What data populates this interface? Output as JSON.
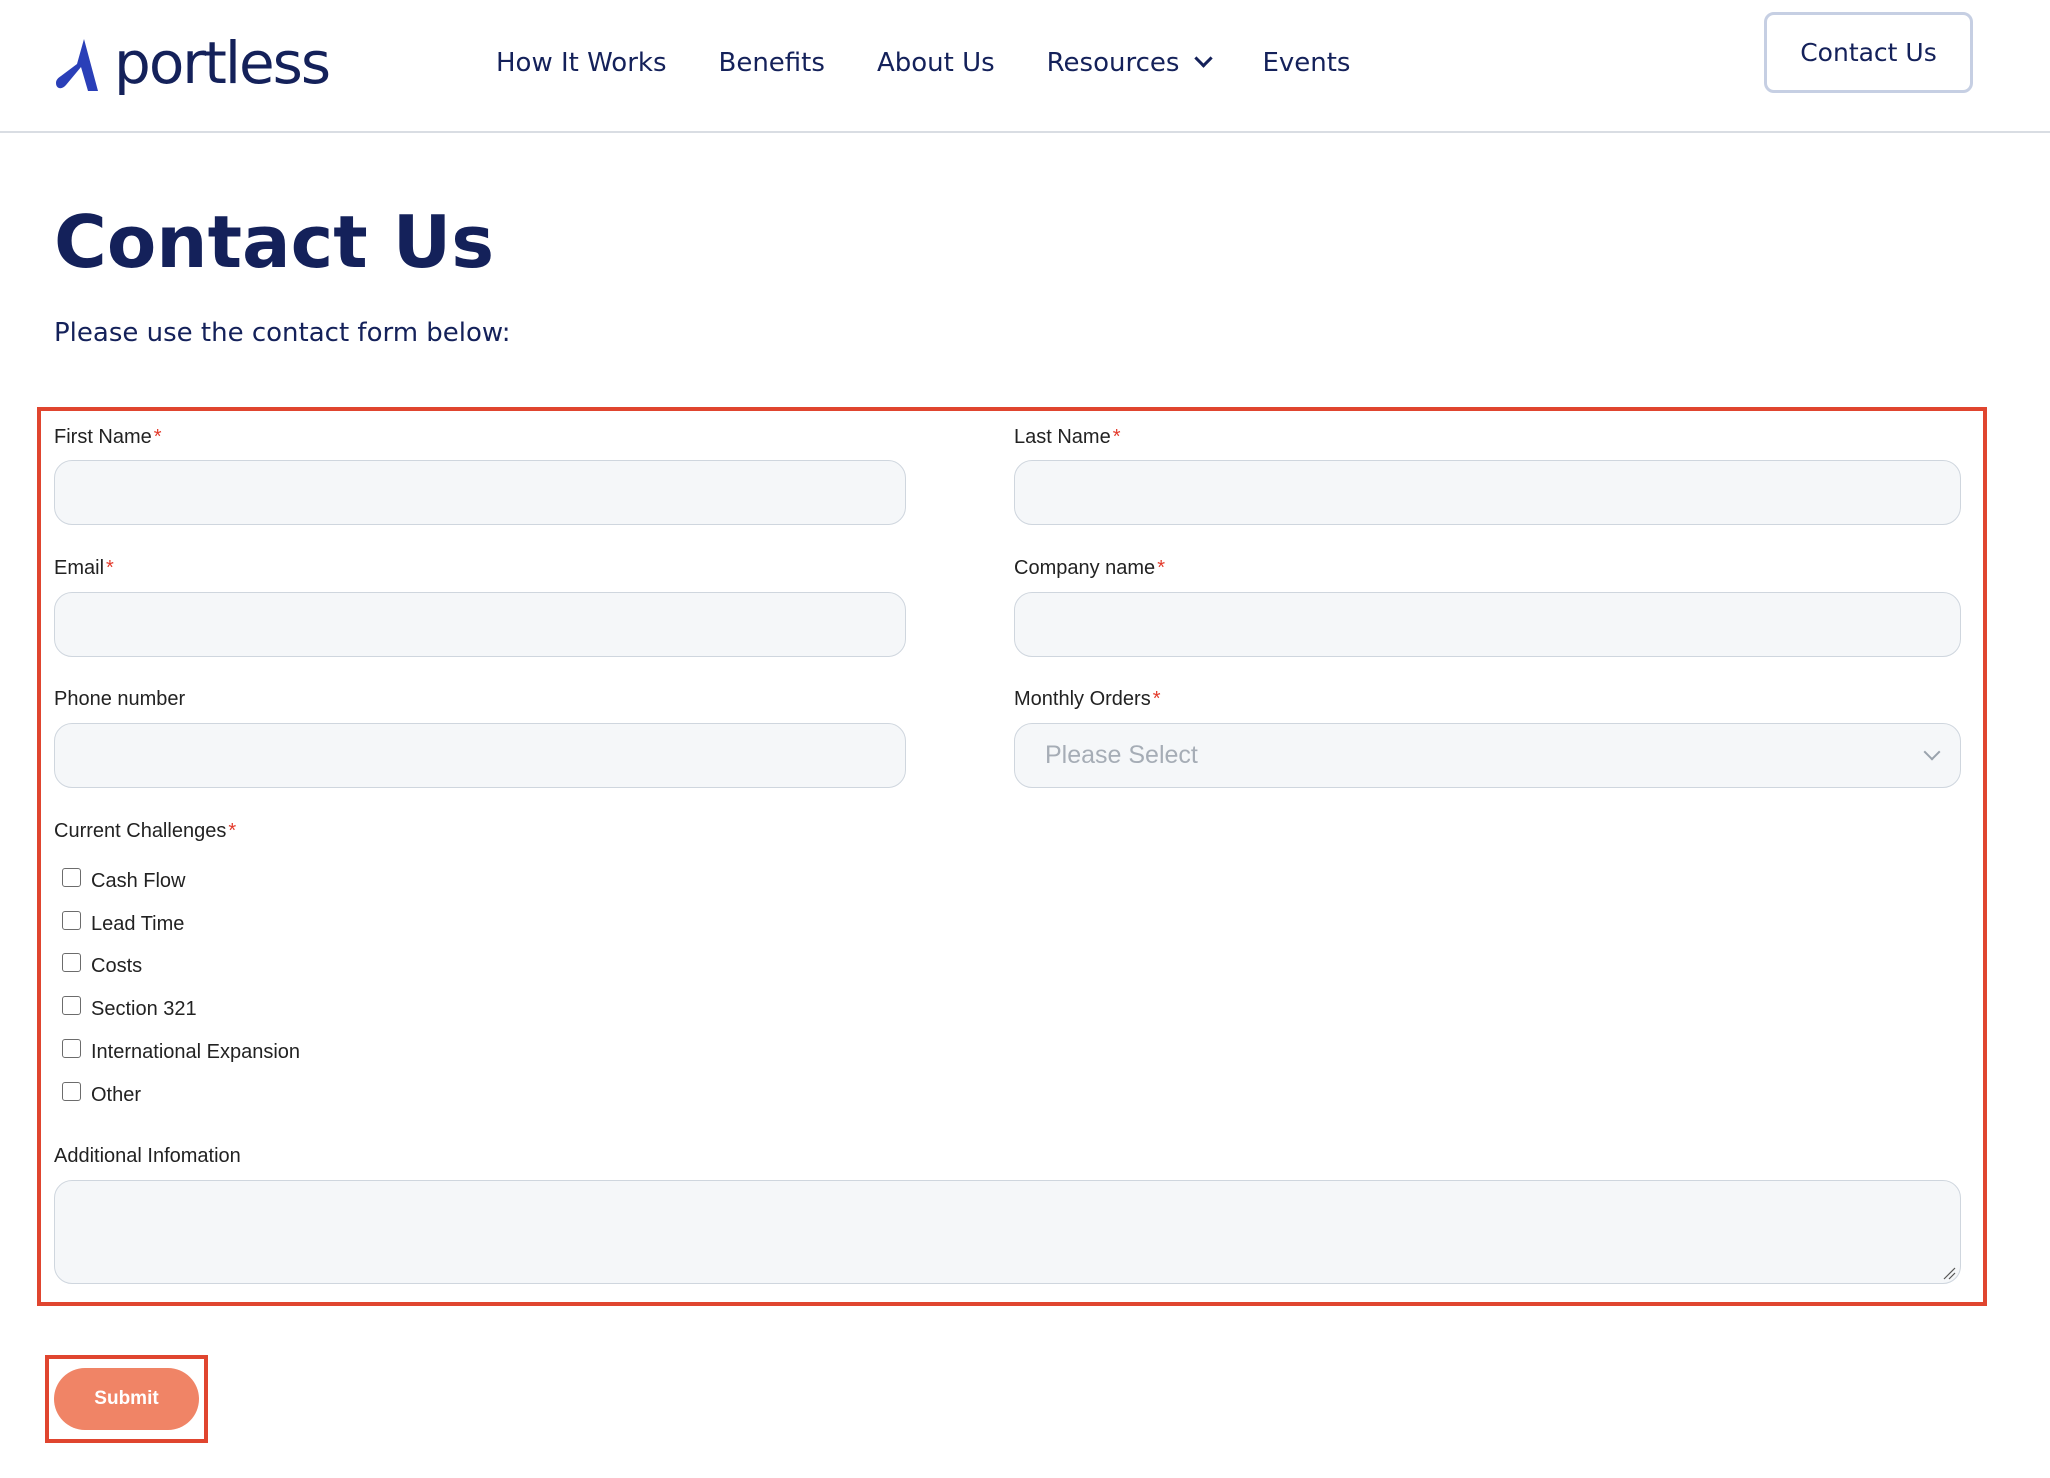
{
  "header": {
    "logo_text": "portless",
    "nav": [
      {
        "label": "How It Works"
      },
      {
        "label": "Benefits"
      },
      {
        "label": "About Us"
      },
      {
        "label": "Resources"
      },
      {
        "label": "Events"
      }
    ],
    "contact_label": "Contact Us"
  },
  "page": {
    "title": "Contact Us",
    "subtitle": "Please use the contact form below:"
  },
  "form": {
    "first_name": {
      "label": "First Name",
      "required": "*"
    },
    "last_name": {
      "label": "Last Name",
      "required": "*"
    },
    "email": {
      "label": "Email",
      "required": "*"
    },
    "company": {
      "label": "Company name",
      "required": "*"
    },
    "phone": {
      "label": "Phone number"
    },
    "monthly_orders": {
      "label": "Monthly Orders",
      "required": "*",
      "value": "Please Select"
    },
    "challenges": {
      "label": "Current Challenges",
      "required": "*",
      "options": [
        {
          "label": "Cash Flow"
        },
        {
          "label": "Lead Time"
        },
        {
          "label": "Costs"
        },
        {
          "label": "Section 321"
        },
        {
          "label": "International Expansion"
        },
        {
          "label": "Other"
        }
      ]
    },
    "additional": {
      "label": "Additional Infomation"
    },
    "submit_label": "Submit"
  },
  "colors": {
    "brand_navy": "#14215a",
    "logo_blue": "#2a3fb8",
    "highlight_red": "#e0452f",
    "submit_orange": "#f08466",
    "required_red": "#e33a2b"
  }
}
